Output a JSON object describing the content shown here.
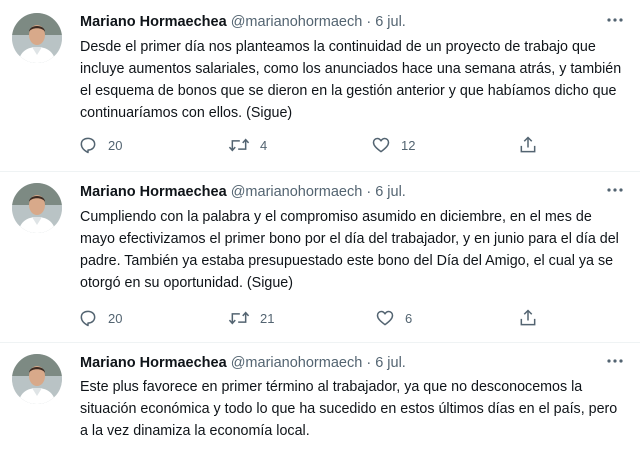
{
  "tweets": [
    {
      "author_name": "Mariano Hormaechea",
      "handle": "@marianohormaech",
      "separator": "·",
      "time": "6 jul.",
      "text": "Desde el primer día nos planteamos la continuidad de un proyecto de trabajo que incluye aumentos salariales, como los anunciados hace una semana atrás, y también el esquema de bonos que se dieron en la gestión anterior y que habíamos dicho que continuaríamos con ellos. (Sigue)",
      "replies": "20",
      "retweets": "4",
      "likes": "12",
      "more_icon": "ellipsis-icon"
    },
    {
      "author_name": "Mariano Hormaechea",
      "handle": "@marianohormaech",
      "separator": "·",
      "time": "6 jul.",
      "text": "Cumpliendo con la palabra y el compromiso asumido en diciembre, en el mes de mayo efectivizamos el primer bono por el día del trabajador, y en junio para el día del padre. También ya estaba presupuestado este bono del Día del Amigo, el cual ya se otorgó en su oportunidad. (Sigue)",
      "replies": "20",
      "retweets": "21",
      "likes": "6",
      "more_icon": "ellipsis-icon"
    },
    {
      "author_name": "Mariano Hormaechea",
      "handle": "@marianohormaech",
      "separator": "·",
      "time": "6 jul.",
      "text": "Este plus favorece en primer término al trabajador, ya que no desconocemos la situación económica y todo lo que ha sucedido en estos últimos días en el país, pero a la vez dinamiza la economía local.",
      "more_icon": "ellipsis-icon"
    }
  ],
  "icons": {
    "reply": "reply-icon",
    "retweet": "retweet-icon",
    "like": "heart-icon",
    "share": "share-icon"
  },
  "colors": {
    "text": "#0f1419",
    "secondary": "#536471",
    "divider": "#eff3f4"
  }
}
